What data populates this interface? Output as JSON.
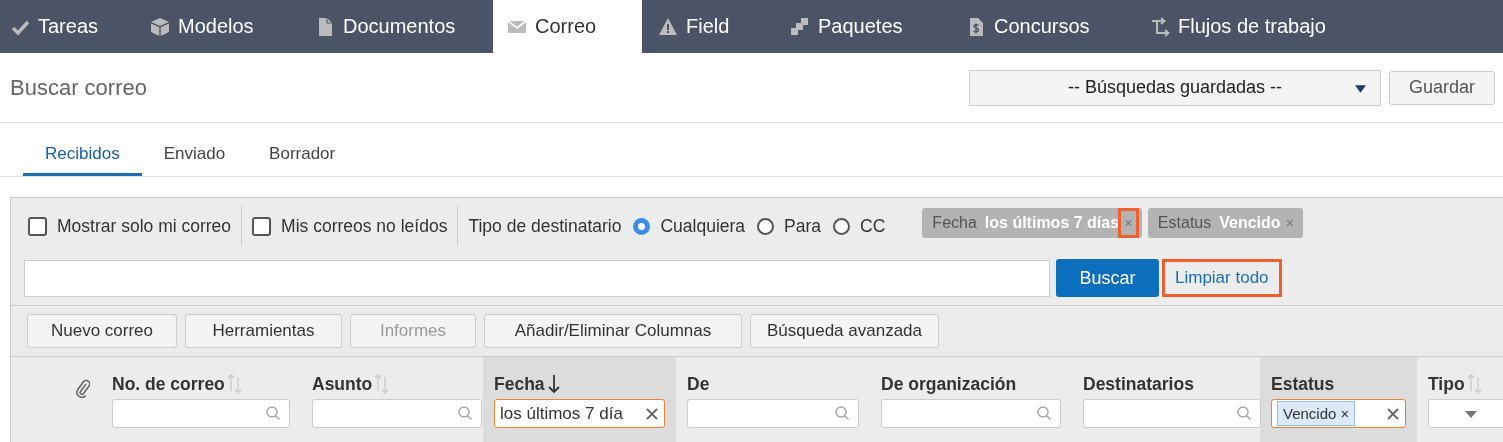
{
  "nav_tabs": [
    {
      "label": "Tareas",
      "selected": false
    },
    {
      "label": "Modelos",
      "selected": false
    },
    {
      "label": "Documentos",
      "selected": false
    },
    {
      "label": "Correo",
      "selected": true
    },
    {
      "label": "Field",
      "selected": false
    },
    {
      "label": "Paquetes",
      "selected": false
    },
    {
      "label": "Concursos",
      "selected": false
    },
    {
      "label": "Flujos de trabajo",
      "selected": false
    }
  ],
  "page_title": "Buscar correo",
  "saved_searches": {
    "value": "-- Búsquedas guardadas --"
  },
  "save_button": "Guardar",
  "sub_tabs": [
    {
      "label": "Recibidos",
      "selected": true
    },
    {
      "label": "Enviado",
      "selected": false
    },
    {
      "label": "Borrador",
      "selected": false
    }
  ],
  "checkboxes": [
    {
      "label": "Mostrar solo mi correo",
      "checked": false
    },
    {
      "label": "Mis correos no leídos",
      "checked": false
    }
  ],
  "recipient_type": {
    "label": "Tipo de destinatario",
    "options": [
      {
        "label": "Cualquiera",
        "selected": true
      },
      {
        "label": "Para",
        "selected": false
      },
      {
        "label": "CC",
        "selected": false
      }
    ]
  },
  "filter_chips": [
    {
      "field": "Fecha",
      "value": "los últimos 7 días",
      "highlighted": true
    },
    {
      "field": "Estatus",
      "value": "Vencido",
      "highlighted": false
    }
  ],
  "chip_close": "×",
  "search_button": "Buscar",
  "clear_all": {
    "label": "Limpiar todo",
    "highlighted": true
  },
  "toolbar": [
    {
      "label": "Nuevo correo",
      "disabled": false
    },
    {
      "label": "Herramientas",
      "disabled": false
    },
    {
      "label": "Informes",
      "disabled": true
    },
    {
      "label": "Añadir/Eliminar Columnas",
      "disabled": false
    },
    {
      "label": "Búsqueda avanzada",
      "disabled": false
    }
  ],
  "columns": [
    {
      "kind": "attachment"
    },
    {
      "kind": "column",
      "label": "No. de correo",
      "sortable": true,
      "filtered": false,
      "filter": {
        "kind": "search"
      }
    },
    {
      "kind": "column",
      "label": "Asunto",
      "sortable": true,
      "filtered": false,
      "filter": {
        "kind": "search"
      }
    },
    {
      "kind": "column",
      "label": "Fecha",
      "sorted_descending": true,
      "filtered": true,
      "filter": {
        "kind": "text",
        "value": "los últimos 7 día"
      }
    },
    {
      "kind": "column",
      "label": "De",
      "filtered": false,
      "filter": {
        "kind": "search"
      }
    },
    {
      "kind": "column",
      "label": "De organización",
      "filtered": false,
      "filter": {
        "kind": "search"
      }
    },
    {
      "kind": "column",
      "label": "Destinatarios",
      "filtered": false,
      "filter": {
        "kind": "search"
      }
    },
    {
      "kind": "column",
      "label": "Estatus",
      "filtered": true,
      "filter": {
        "kind": "tags",
        "tags": [
          "Vencido"
        ]
      }
    },
    {
      "kind": "column",
      "label": "Tipo",
      "sortable": true,
      "filtered": false,
      "filter": {
        "kind": "select"
      }
    }
  ]
}
